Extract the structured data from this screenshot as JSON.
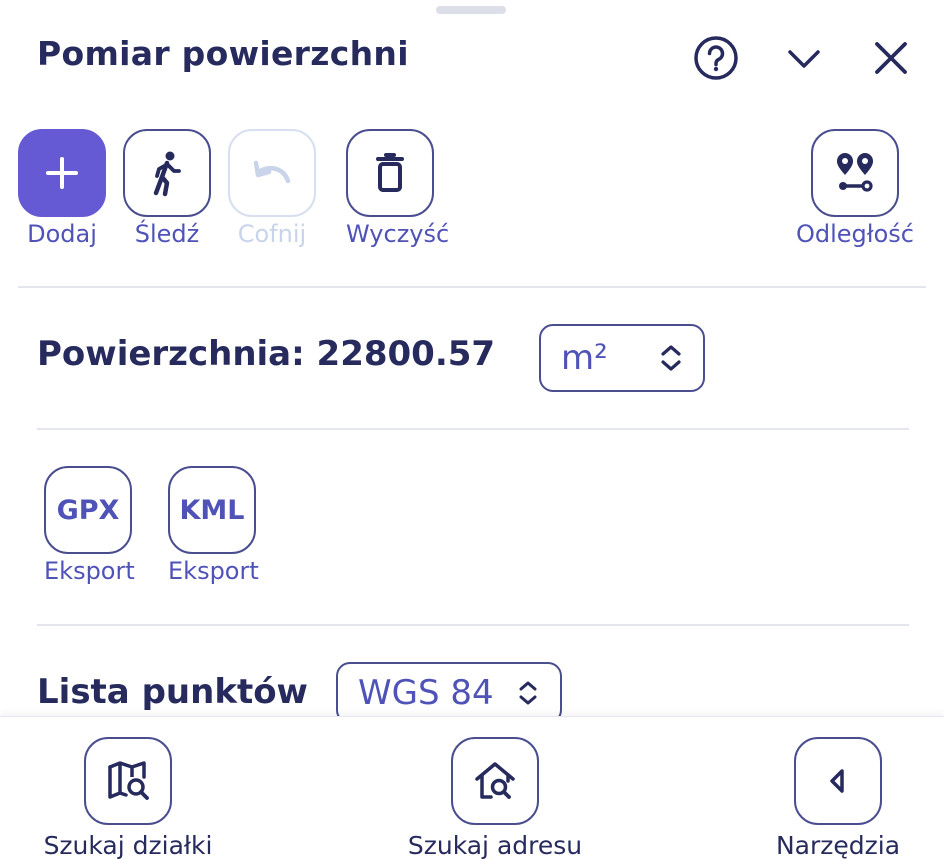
{
  "panel": {
    "title": "Pomiar powierzchni",
    "icons": {
      "help": "help-circle-icon",
      "collapse": "chevron-down-icon",
      "close": "close-icon"
    }
  },
  "toolbar": {
    "add_label": "Dodaj",
    "track_label": "Śledź",
    "undo_label": "Cofnij",
    "clear_label": "Wyczyść",
    "distance_label": "Odległość",
    "undo_disabled": true
  },
  "area": {
    "label": "Powierzchnia: 22800.57",
    "unit": "m²"
  },
  "export": {
    "items": [
      {
        "format": "GPX",
        "label": "Eksport"
      },
      {
        "format": "KML",
        "label": "Eksport"
      }
    ]
  },
  "points": {
    "label": "Lista punktów",
    "crs": "WGS 84"
  },
  "bottom_nav": {
    "items": [
      {
        "label": "Szukaj działki",
        "icon": "map-search-icon"
      },
      {
        "label": "Szukaj adresu",
        "icon": "home-search-icon"
      },
      {
        "label": "Narzędzia",
        "icon": "arrow-left-icon"
      }
    ]
  },
  "colors": {
    "primary": "#6559d4",
    "accent_text": "#4f53b8",
    "dark_text": "#262a5c",
    "border": "#4a4e8f",
    "disabled": "#c9d3ea"
  }
}
